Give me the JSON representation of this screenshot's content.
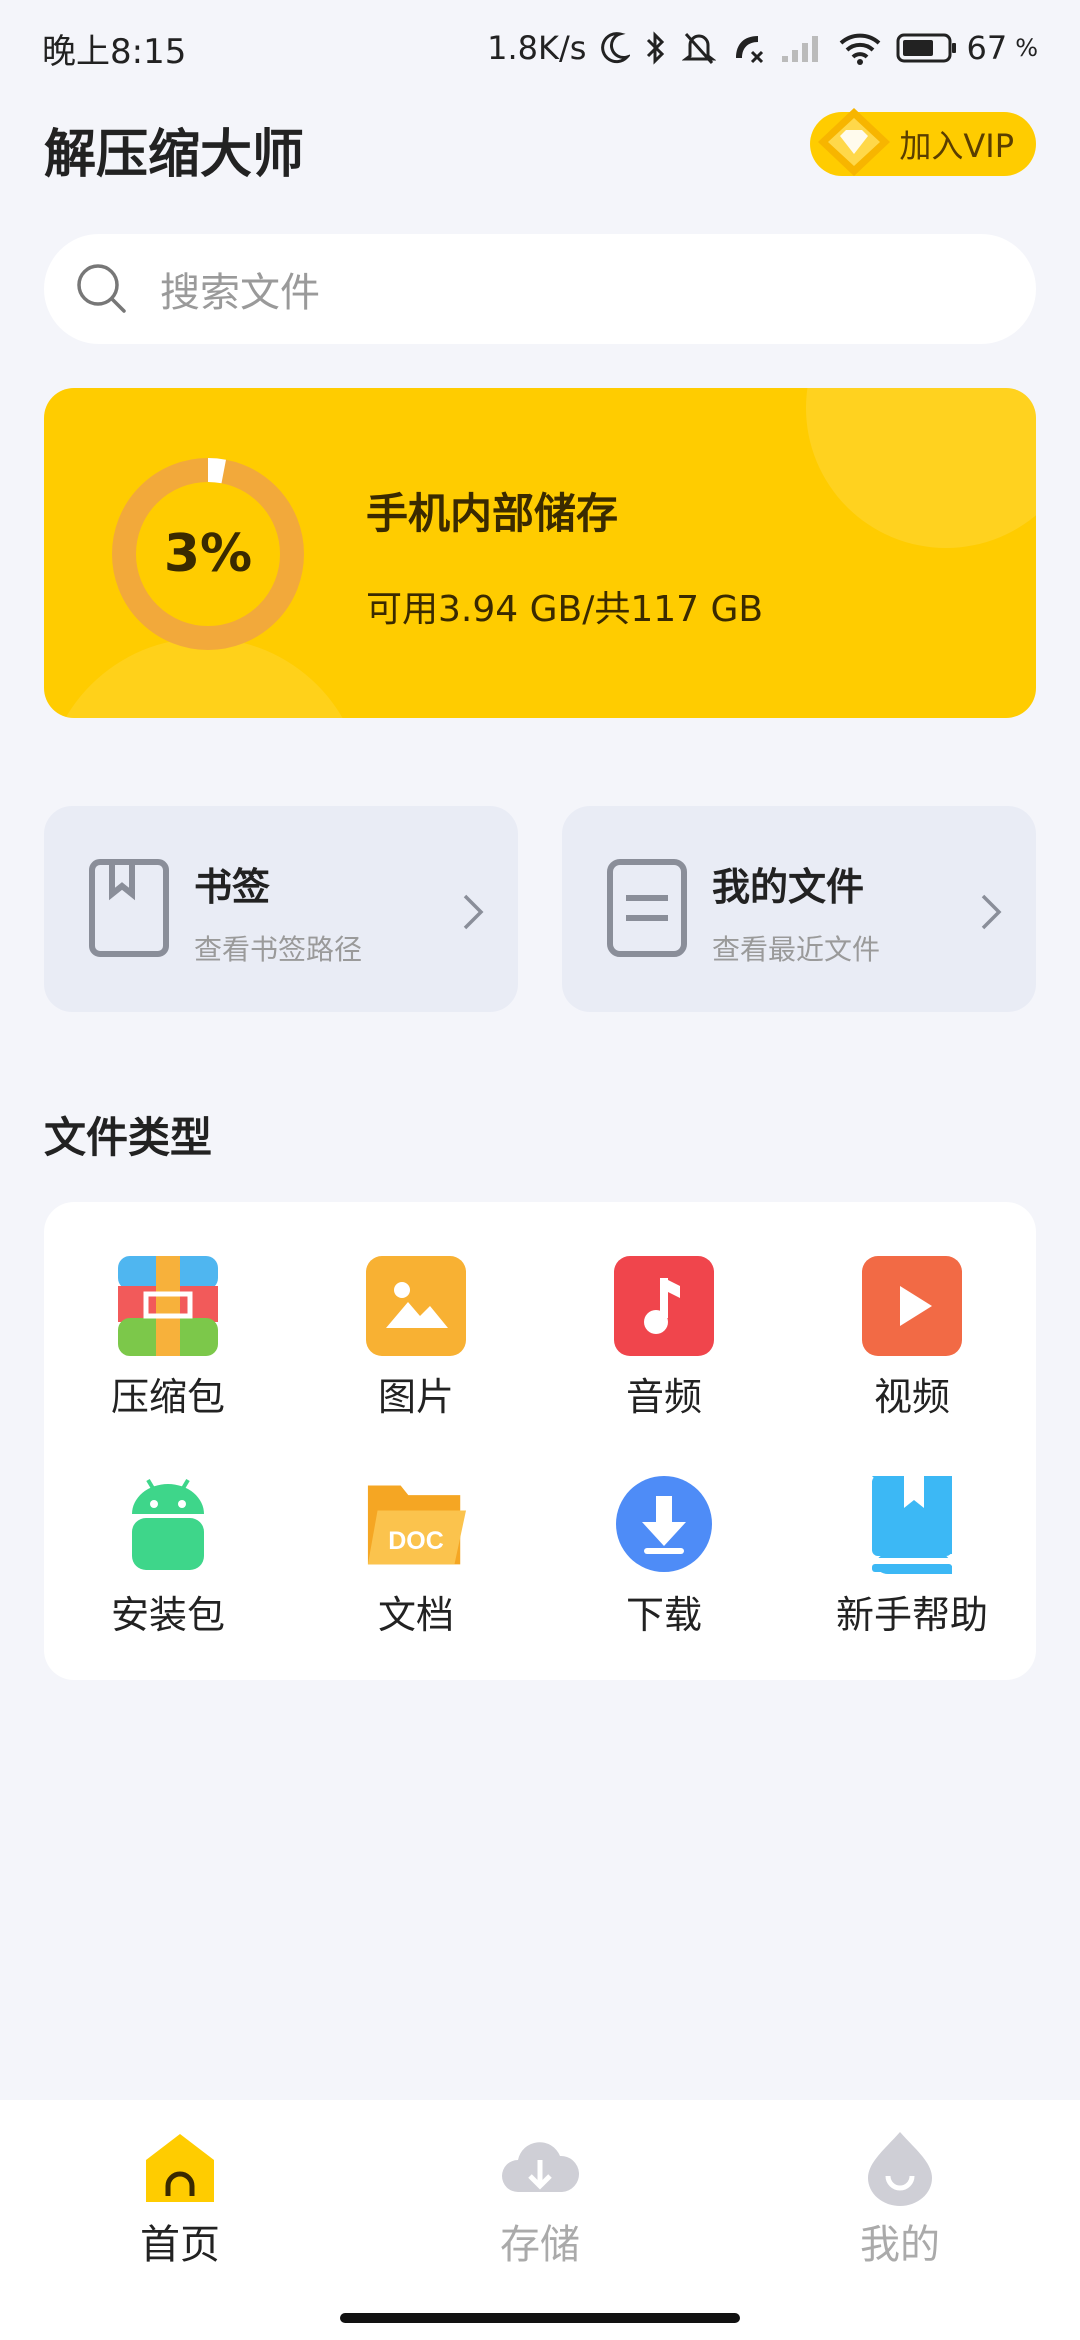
{
  "status_bar": {
    "time": "晚上8:15",
    "speed": "1.8K/s",
    "battery": "67"
  },
  "header": {
    "title": "解压缩大师",
    "vip_label": "加入VIP"
  },
  "search": {
    "placeholder": "搜索文件"
  },
  "storage": {
    "percent_label": "3%",
    "used_fraction": 0.03,
    "title": "手机内部储存",
    "subtitle": "可用3.94 GB/共117 GB"
  },
  "quick_cards": [
    {
      "title": "书签",
      "subtitle": "查看书签路径"
    },
    {
      "title": "我的文件",
      "subtitle": "查看最近文件"
    }
  ],
  "file_types": {
    "section_title": "文件类型",
    "items": [
      {
        "label": "压缩包",
        "icon": "archive-icon"
      },
      {
        "label": "图片",
        "icon": "image-icon"
      },
      {
        "label": "音频",
        "icon": "audio-icon"
      },
      {
        "label": "视频",
        "icon": "video-icon"
      },
      {
        "label": "安装包",
        "icon": "android-icon"
      },
      {
        "label": "文档",
        "icon": "doc-folder-icon"
      },
      {
        "label": "下载",
        "icon": "download-icon"
      },
      {
        "label": "新手帮助",
        "icon": "help-book-icon"
      }
    ]
  },
  "bottom_nav": {
    "items": [
      {
        "label": "首页",
        "icon": "home-icon",
        "active": true
      },
      {
        "label": "存储",
        "icon": "cloud-download-icon",
        "active": false
      },
      {
        "label": "我的",
        "icon": "profile-drop-icon",
        "active": false
      }
    ]
  },
  "colors": {
    "accent": "#FFCC00",
    "background": "#F4F5FA",
    "ring_track": "#F2A93B"
  },
  "doc_icon_text": "DOC"
}
